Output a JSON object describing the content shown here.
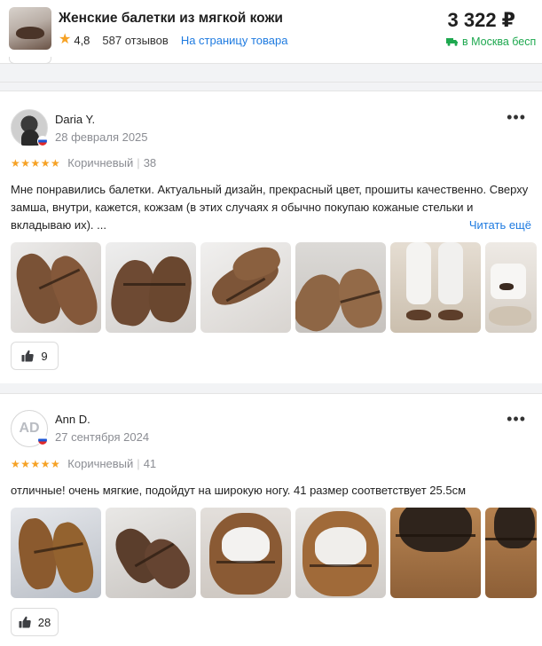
{
  "product": {
    "title": "Женские балетки из мягкой кожи",
    "rating": "4,8",
    "reviews_count": "587 отзывов",
    "link_label": "На страницу товара",
    "price": "3 322 ₽",
    "delivery": "в Москва бесп"
  },
  "reviews": [
    {
      "author": "Daria Y.",
      "date": "28 февраля 2025",
      "stars": "★★★★★",
      "variant": "Коричневый",
      "size": "38",
      "text": "Мне понравились балетки. Актуальный дизайн, прекрасный цвет, прошиты качественно. Сверху замша, внутри, кажется, кожзам (в этих случаях я обычно покупаю кожаные стельки и вкладываю их). ...",
      "read_more": "Читать ещё",
      "likes": "9",
      "photo_count": 6
    },
    {
      "author": "Ann D.",
      "avatar_initials": "AD",
      "date": "27 сентября 2024",
      "stars": "★★★★★",
      "variant": "Коричневый",
      "size": "41",
      "text": "отличные! очень мягкие, подойдут на широкую ногу. 41 размер соответствует 25.5см",
      "likes": "28",
      "photo_count": 6
    }
  ],
  "colors": {
    "accent_link": "#1f7be0",
    "star": "#f6a225",
    "delivery_green": "#1ea84f",
    "suede_brown": "#8b5e3c"
  }
}
